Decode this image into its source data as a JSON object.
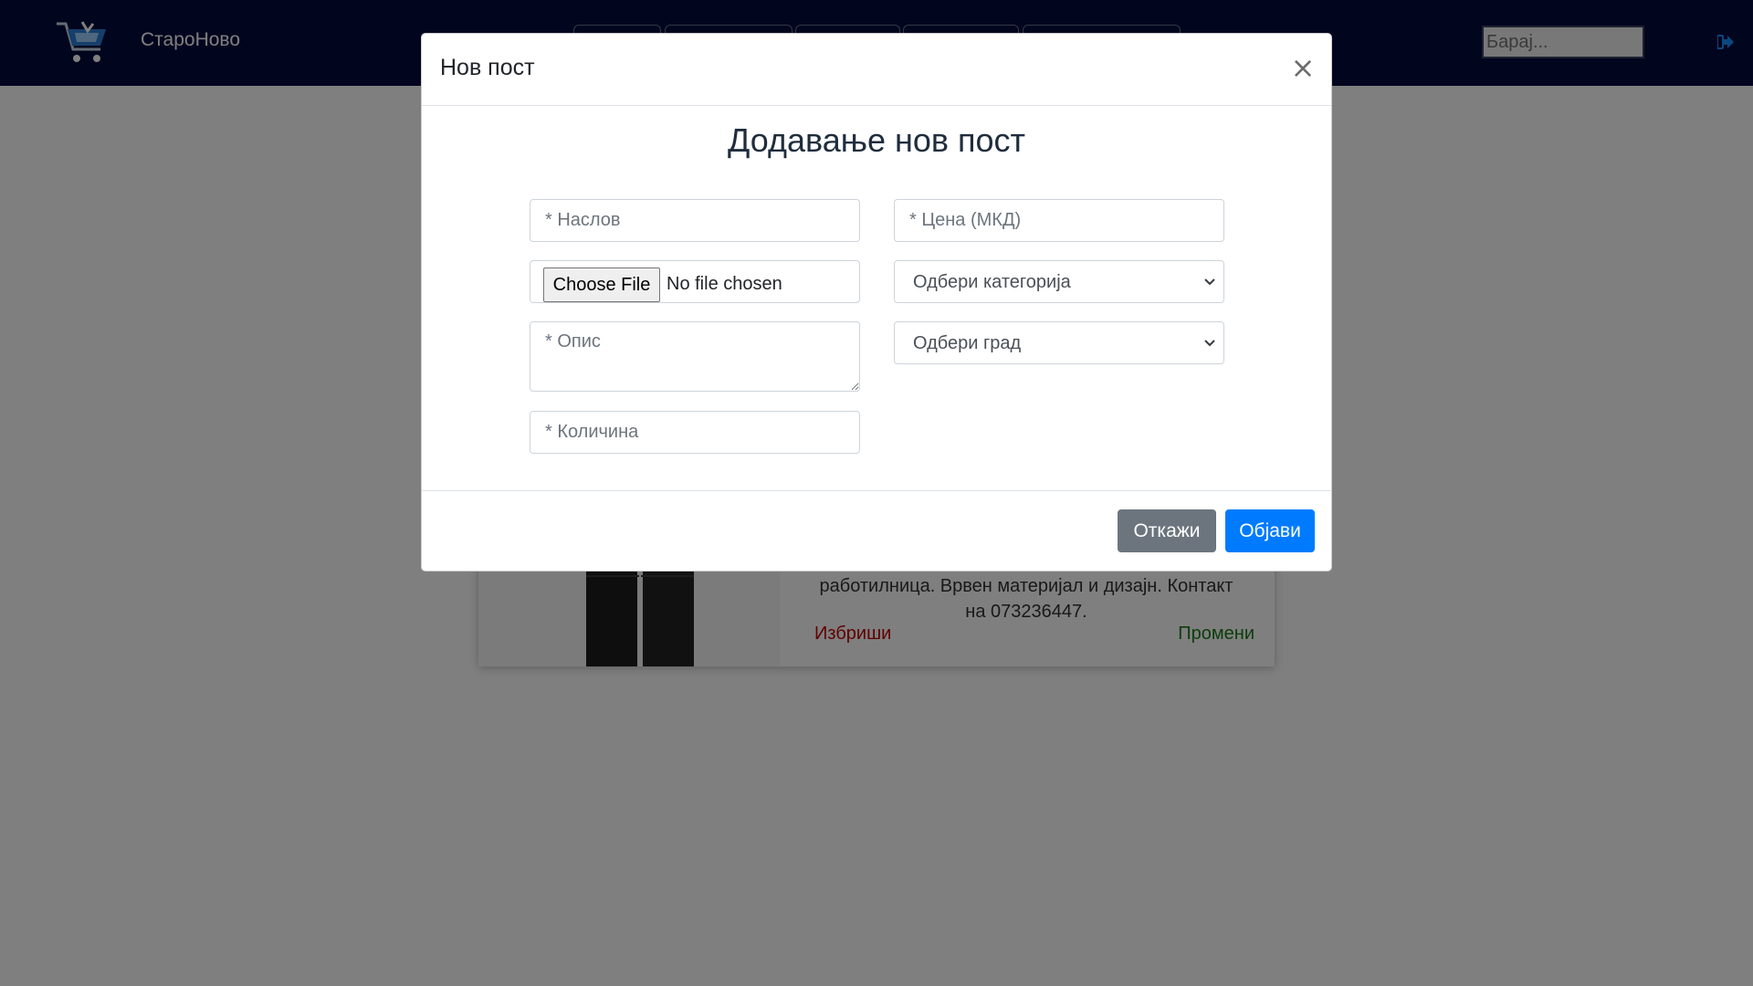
{
  "header": {
    "brand": "СтароНово",
    "search_placeholder": "Барај...",
    "logo_icon": "shopping-cart-icon",
    "logout_icon": "sign-out-icon"
  },
  "card": {
    "description": "работилница. Врвен материјал и дизајн. Контакт на 073236447.",
    "delete_label": "Избриши",
    "edit_label": "Промени"
  },
  "modal": {
    "title": "Нов пост",
    "heading": "Додавање нов пост",
    "close_symbol": "×",
    "fields": {
      "title_placeholder": "* Наслов",
      "price_placeholder": "* Цена (МКД)",
      "file_button": "Choose File",
      "file_status": "No file chosen",
      "category_selected": "Одбери категорија",
      "description_placeholder": "* Опис",
      "city_selected": "Одбери град",
      "quantity_placeholder": "* Количина"
    },
    "buttons": {
      "cancel": "Откажи",
      "publish": "Објави"
    }
  },
  "colors": {
    "navbar": "#020a3d",
    "primary": "#007bff",
    "secondary": "#6c757d",
    "delete": "#c00000",
    "edit": "#1a7a1a"
  }
}
